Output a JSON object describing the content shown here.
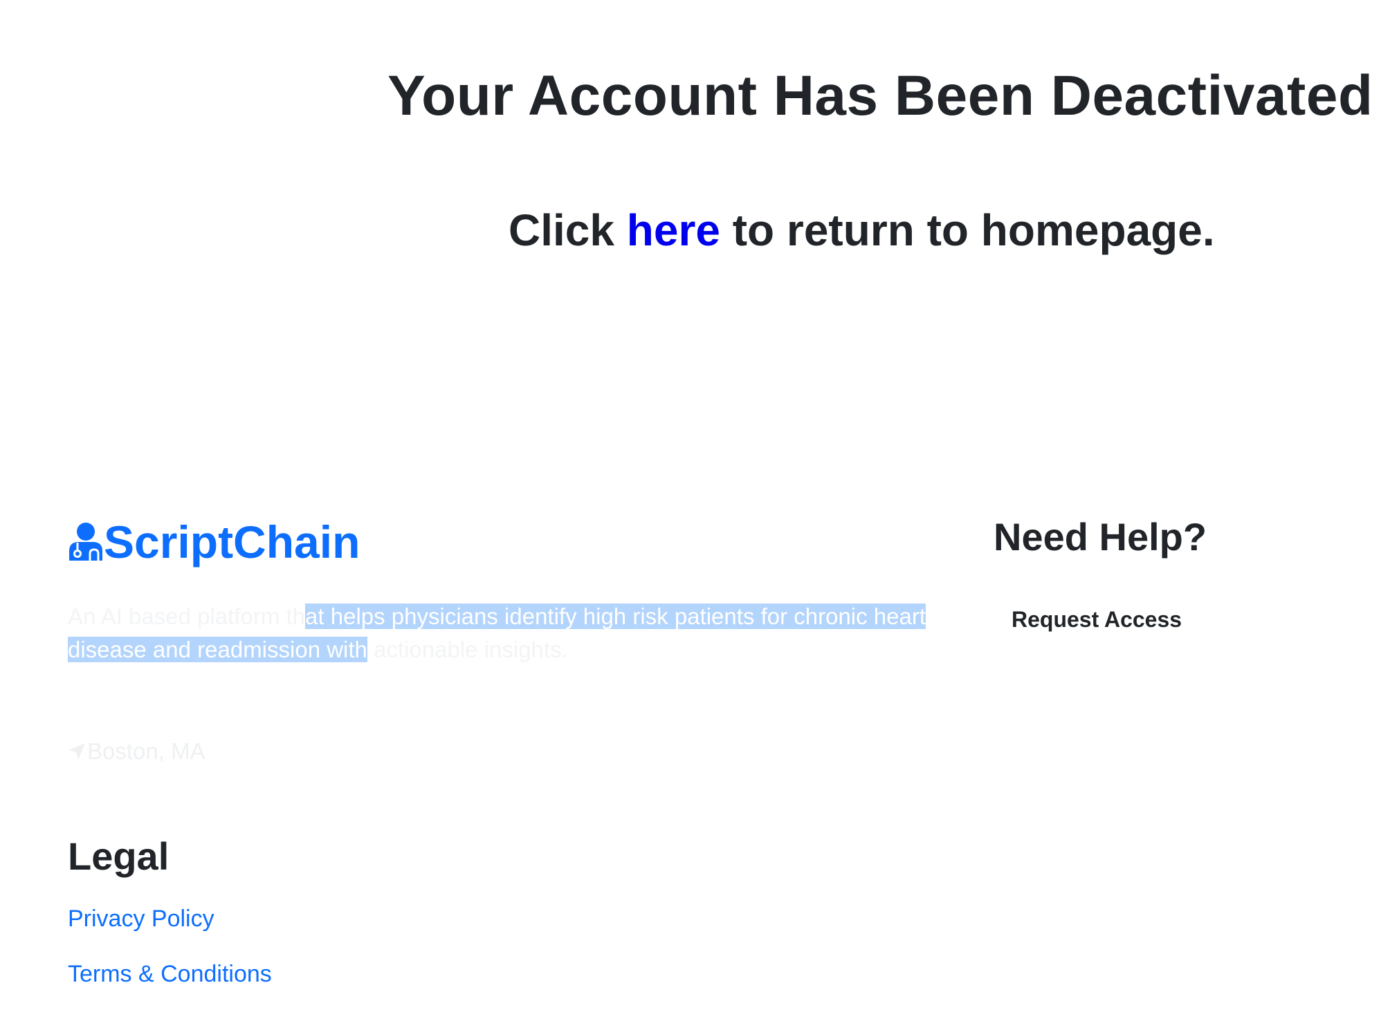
{
  "header": {
    "title": "Your Account Has Been Deactivated",
    "return_prefix": "Click",
    "return_link": "here",
    "return_suffix": "to return to homepage."
  },
  "footer": {
    "brand": {
      "name": "ScriptChain",
      "icon": "doctor-icon",
      "color": "#0d6efd"
    },
    "tagline": {
      "part1": "An AI based platform th",
      "part2_selected": "at helps physicians identify high risk patients for chronic heart disease and readmission with",
      "part3": " actionable insights."
    },
    "location": {
      "icon": "location-arrow-icon",
      "text": "Boston, MA"
    },
    "legal": {
      "heading": "Legal",
      "links": [
        "Privacy Policy",
        "Terms & Conditions"
      ]
    },
    "help": {
      "heading": "Need Help?",
      "request_access": "Request Access"
    }
  },
  "colors": {
    "link_blue": "#0000ee",
    "brand_blue": "#0d6efd",
    "selection": "#b3d4fc",
    "text_dark": "#212529"
  }
}
